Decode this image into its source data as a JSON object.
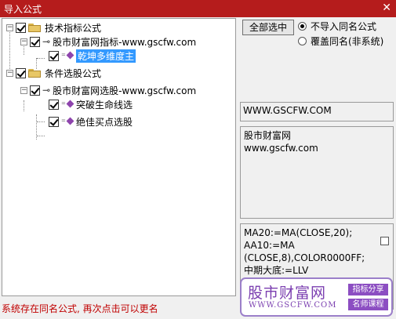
{
  "window": {
    "title": "导入公式",
    "close_glyph": "✕"
  },
  "tree": {
    "groups": [
      {
        "label": "技术指标公式",
        "source": "股市财富网指标-www.gscfw.com",
        "items": [
          "乾坤多维度主"
        ]
      },
      {
        "label": "条件选股公式",
        "source": "股市财富网选股-www.gscfw.com",
        "items": [
          "突破生命线选",
          "绝佳买点选股"
        ]
      }
    ]
  },
  "controls": {
    "select_all": "全部选中",
    "radio_skip": "不导入同名公式",
    "radio_overwrite": "覆盖同名(非系统)"
  },
  "info": {
    "website": "WWW.GSCFW.COM",
    "desc_line1": "股市财富网",
    "desc_line2": "www.gscfw.com",
    "code_lines": [
      "MA20:=MA(CLOSE,20);",
      "AA10:=MA",
      "(CLOSE,8),COLOR0000FF;",
      "中期大底:=LLV"
    ]
  },
  "status": "系统存在同名公式, 再次点击可以更名",
  "watermark": {
    "big": "股市财富网",
    "url": "WWW.GSCFW.COM",
    "tag1": "指标分享",
    "tag2": "名师课程"
  },
  "colors": {
    "titlebar": "#b51c1c",
    "selection": "#3399ff",
    "status": "#c00000",
    "watermark": "#7b3fb0"
  }
}
